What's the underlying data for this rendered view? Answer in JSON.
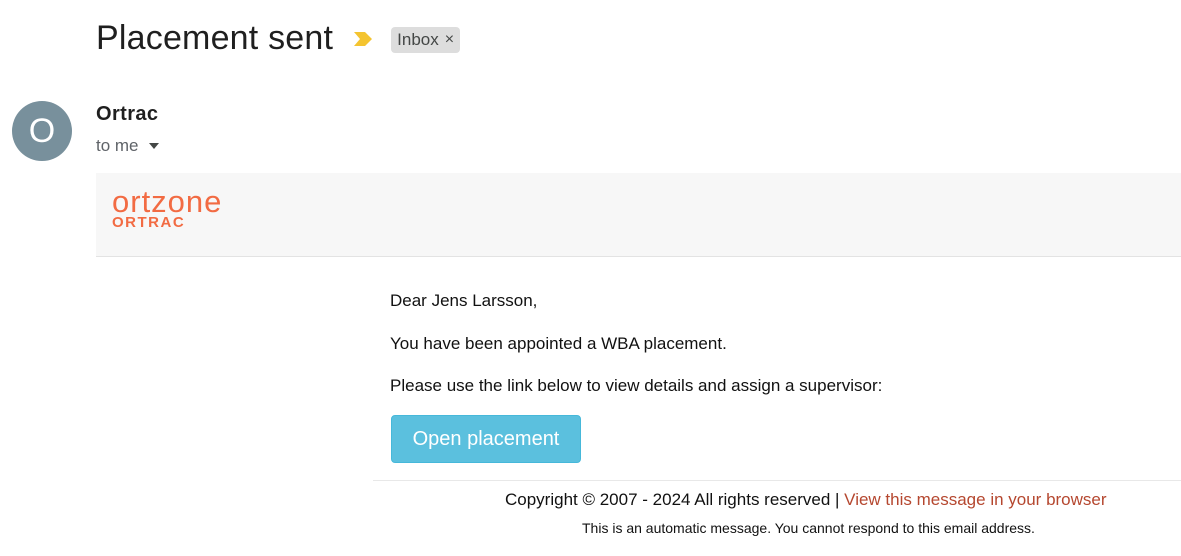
{
  "email": {
    "subject": "Placement sent",
    "importance_icon": "importance-marker-icon",
    "importance_color": "#f4c430",
    "label": {
      "name": "Inbox",
      "remove": "×"
    },
    "sender": {
      "avatar_letter": "O",
      "avatar_color": "#78909c",
      "name": "Ortrac"
    },
    "recipient": "to me"
  },
  "banner": {
    "logo_word": "ortzone",
    "logo_sub": "ORTRAC",
    "brand_color": "#f26b43"
  },
  "message": {
    "greeting": "Dear Jens Larsson,",
    "line1": "You have been appointed a WBA placement.",
    "line2": "Please use the link below to view details and assign a supervisor:",
    "button_label": "Open placement",
    "button_color": "#5bc0de"
  },
  "footer": {
    "copyright": "Copyright © 2007 - 2024 All rights reserved | ",
    "browser_link": "View this message in your browser",
    "notice": "This is an automatic message. You cannot respond to this email address."
  }
}
